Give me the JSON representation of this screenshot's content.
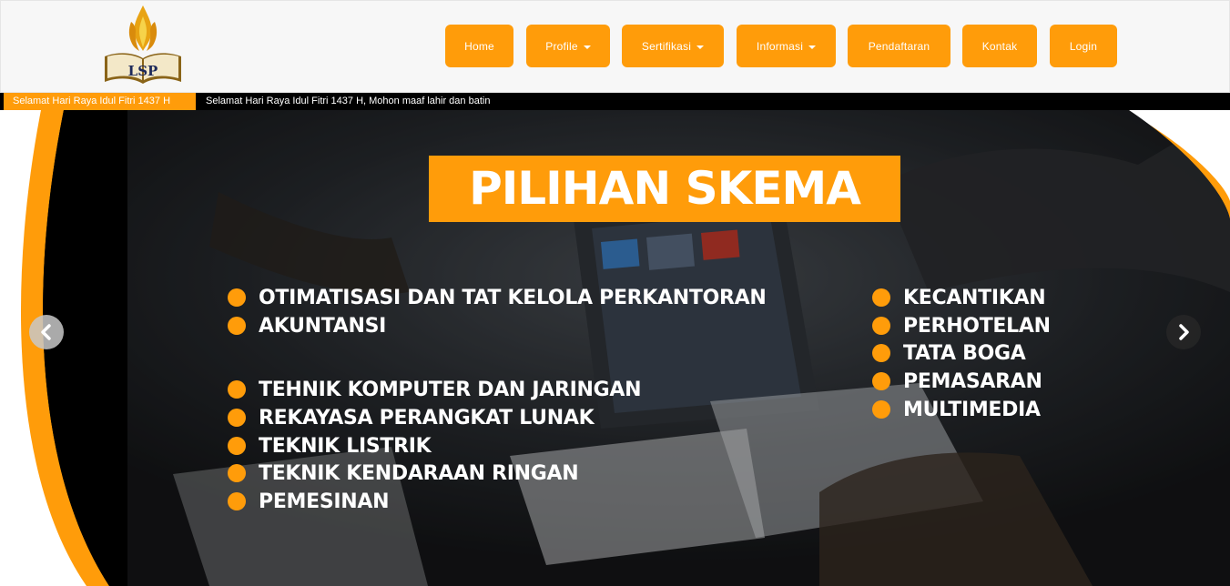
{
  "logo": {
    "text": "LSP"
  },
  "nav": {
    "items": [
      {
        "label": "Home",
        "dropdown": false
      },
      {
        "label": "Profile",
        "dropdown": true
      },
      {
        "label": "Sertifikasi",
        "dropdown": true
      },
      {
        "label": "Informasi",
        "dropdown": true
      },
      {
        "label": "Pendaftaran",
        "dropdown": false
      },
      {
        "label": "Kontak",
        "dropdown": false
      },
      {
        "label": "Login",
        "dropdown": false
      }
    ]
  },
  "ticker": {
    "label": "Selamat Hari Raya Idul Fitri 1437 H",
    "text": "Selamat Hari Raya Idul Fitri 1437 H, Mohon maaf lahir dan batin"
  },
  "slide": {
    "title": "PILIHAN SKEMA",
    "left_list": [
      "OTIMATISASI DAN TAT KELOLA PERKANTORAN",
      "AKUNTANSI",
      "TEHNIK KOMPUTER DAN JARINGAN",
      "REKAYASA PERANGKAT LUNAK",
      "TEKNIK LISTRIK",
      "TEKNIK KENDARAAN RINGAN",
      "PEMESINAN"
    ],
    "right_list": [
      "KECANTIKAN",
      "PERHOTELAN",
      "TATA BOGA",
      "PEMASARAN",
      "MULTIMEDIA"
    ]
  },
  "carousel": {
    "prev_icon": "chevron-left-icon",
    "next_icon": "chevron-right-icon"
  },
  "colors": {
    "accent": "#ff9c0a",
    "header_bg": "#f7f7f7",
    "ticker_bg": "#000000"
  }
}
